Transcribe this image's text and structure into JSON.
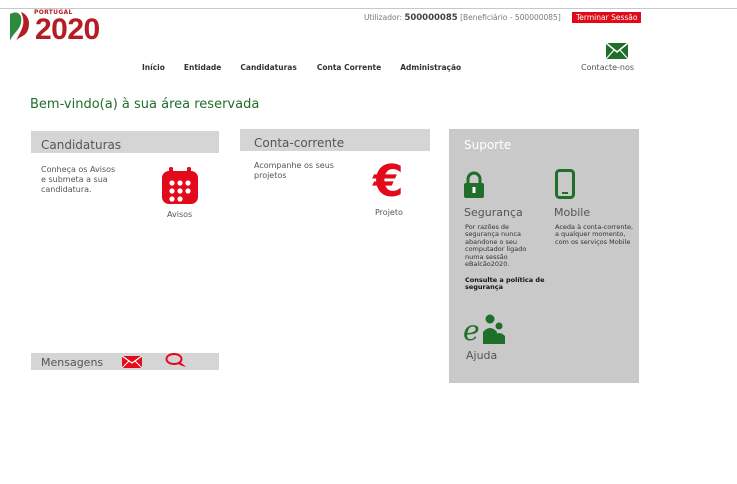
{
  "brand": {
    "country": "PORTUGAL",
    "year": "2020",
    "colors": {
      "red": "#b21e23",
      "green": "#1f6e2a"
    }
  },
  "user": {
    "prefix": "Utilizador:",
    "id": "500000085",
    "role": "[Beneficiário - 500000085]",
    "logout": "Terminar Sessão"
  },
  "nav": [
    "Início",
    "Entidade",
    "Candidaturas",
    "Conta Corrente",
    "Administração"
  ],
  "contact": {
    "label": "Contacte-nos",
    "icon": "envelope-icon"
  },
  "welcome": "Bem-vindo(a) à sua área reservada",
  "candidaturas": {
    "title": "Candidaturas",
    "desc": "Conheça os Avisos e submeta a sua candidatura.",
    "link": "Avisos",
    "icon": "calendar-icon"
  },
  "conta": {
    "title": "Conta-corrente",
    "desc": "Acompanhe os seus projetos",
    "link": "Projeto",
    "icon": "euro-icon"
  },
  "suporte": {
    "title": "Suporte",
    "seguranca": {
      "title": "Segurança",
      "desc": "Por razões de segurança nunca abandone o seu computador ligado numa sessão eBalcão2020.",
      "link": "Consulte a política de segurança",
      "icon": "lock-icon"
    },
    "mobile": {
      "title": "Mobile",
      "desc": "Aceda à conta-corrente, a qualquer momento, com os serviços Mobile",
      "icon": "mobile-icon"
    },
    "ajuda": {
      "title": "Ajuda",
      "icon": "help-icon"
    }
  },
  "mensagens": {
    "title": "Mensagens",
    "icons": [
      "envelope-icon",
      "chat-icon"
    ]
  }
}
